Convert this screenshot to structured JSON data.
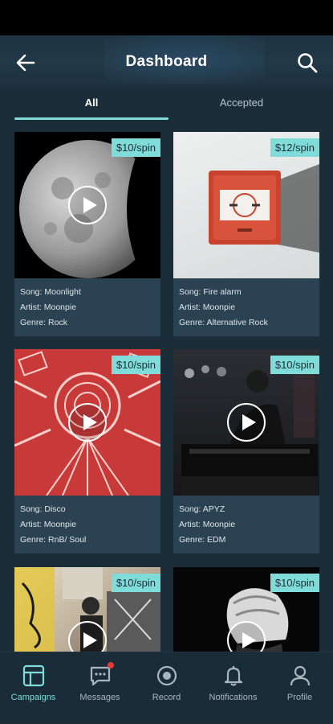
{
  "header": {
    "title": "Dashboard"
  },
  "tabs": [
    {
      "label": "All",
      "active": true
    },
    {
      "label": "Accepted",
      "active": false
    }
  ],
  "cards": [
    {
      "price": "$10/spin",
      "song": "Song:  Moonlight",
      "artist": "Artist:  Moonpie",
      "genre": "Genre:  Rock"
    },
    {
      "price": "$12/spin",
      "song": "Song:  Fire alarm",
      "artist": "Artist:  Moonpie",
      "genre": "Genre:  Alternative Rock"
    },
    {
      "price": "$10/spin",
      "song": "Song:  Disco",
      "artist": "Artist:  Moonpie",
      "genre": "Genre:  RnB/ Soul"
    },
    {
      "price": "$10/spin",
      "song": "Song:  APYZ",
      "artist": "Artist:  Moonpie",
      "genre": "Genre:  EDM"
    },
    {
      "price": "$10/spin"
    },
    {
      "price": "$10/spin"
    }
  ],
  "nav": [
    {
      "label": "Campaigns",
      "icon": "campaigns-icon",
      "active": true
    },
    {
      "label": "Messages",
      "icon": "messages-icon",
      "active": false
    },
    {
      "label": "Record",
      "icon": "record-icon",
      "active": false
    },
    {
      "label": "Notifications",
      "icon": "bell-icon",
      "active": false
    },
    {
      "label": "Profile",
      "icon": "profile-icon",
      "active": false
    }
  ],
  "colors": {
    "accent": "#7fdcd9",
    "background": "#1b2d39",
    "card": "#2a4252",
    "badge": "#e53935"
  }
}
